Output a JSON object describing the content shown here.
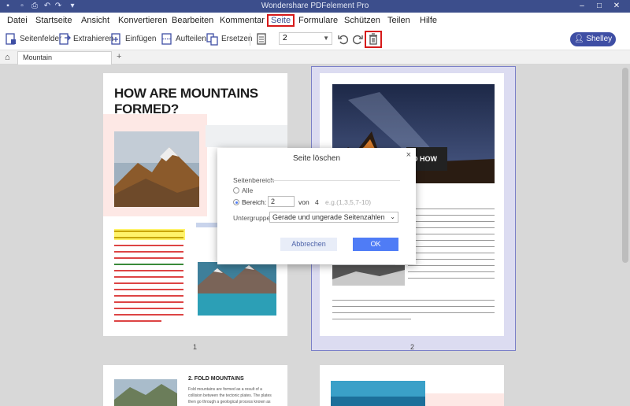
{
  "app": {
    "title": "Wondershare PDFelement Pro"
  },
  "menu": [
    "Datei",
    "Startseite",
    "Ansicht",
    "Konvertieren",
    "Bearbeiten",
    "Kommentar",
    "Seite",
    "Formulare",
    "Schützen",
    "Teilen",
    "Hilfe"
  ],
  "toolbar": {
    "seitenfelder": "Seitenfelder",
    "extrahieren": "Extrahieren",
    "einfuegen": "Einfügen",
    "aufteilen": "Aufteilen",
    "ersetzen": "Ersetzen",
    "page_value": "2",
    "user": "Shelley"
  },
  "tab": {
    "label": "Mountain",
    "add": "+"
  },
  "pages": {
    "p1_title": "HOW ARE MOUNTAINS FORMED?",
    "p1_num": "1",
    "p2_num": "2",
    "p2_heading": "D HOW",
    "p3_title": "2. FOLD MOUNTAINS",
    "p3_text1": "Fold mountains are formed as a result of a",
    "p3_text2": "collision between the tectonic plates. The plates",
    "p3_text3": "then go through a geological process known as"
  },
  "dialog": {
    "title": "Seite löschen",
    "section": "Seitenbereich",
    "alle": "Alle",
    "bereich": "Bereich:",
    "range_value": "2",
    "von": "von",
    "total": "4",
    "hint": "e.g.(1,3,5,7-10)",
    "untergruppe": "Untergruppe:",
    "subgroup_value": "Gerade und ungerade Seitenzahlen",
    "cancel": "Abbrechen",
    "ok": "OK"
  }
}
